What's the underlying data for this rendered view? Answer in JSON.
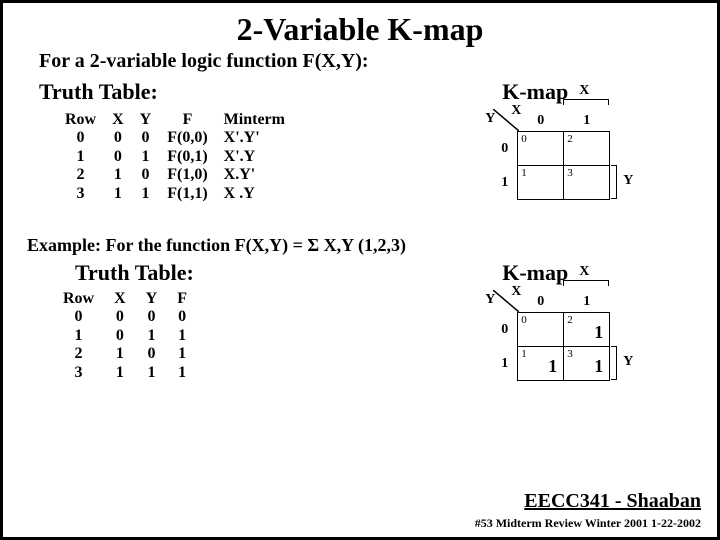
{
  "title": "2-Variable K-map",
  "subtitle": "For a 2-variable logic function F(X,Y):",
  "truth_label": "Truth Table:",
  "kmap_label": "K-map",
  "truth1": {
    "headers": [
      "Row",
      "X",
      "Y",
      "F",
      "Minterm"
    ],
    "rows": [
      [
        "0",
        "0",
        "0",
        "F(0,0)",
        "X'.Y'"
      ],
      [
        "1",
        "0",
        "1",
        "F(0,1)",
        "X'.Y"
      ],
      [
        "2",
        "1",
        "0",
        "F(1,0)",
        "X.Y'"
      ],
      [
        "3",
        "1",
        "1",
        "F(1,1)",
        "X .Y"
      ]
    ]
  },
  "kmap1": {
    "diag_y": "Y",
    "diag_x": "X",
    "col0": "0",
    "col1": "1",
    "row0": "0",
    "row1": "1",
    "cells": [
      {
        "sup": "0",
        "val": ""
      },
      {
        "sup": "2",
        "val": ""
      },
      {
        "sup": "1",
        "val": ""
      },
      {
        "sup": "3",
        "val": ""
      }
    ],
    "x_label": "X",
    "y_label": "Y"
  },
  "example_text": "Example:  For the function F(X,Y) = Σ X,Y (1,2,3)",
  "truth2": {
    "headers": [
      "Row",
      "X",
      "Y",
      "F"
    ],
    "rows": [
      [
        "0",
        "0",
        "0",
        "0"
      ],
      [
        "1",
        "0",
        "1",
        "1"
      ],
      [
        "2",
        "1",
        "0",
        "1"
      ],
      [
        "3",
        "1",
        "1",
        "1"
      ]
    ]
  },
  "kmap2": {
    "diag_y": "Y",
    "diag_x": "X",
    "col0": "0",
    "col1": "1",
    "row0": "0",
    "row1": "1",
    "cells": [
      {
        "sup": "0",
        "val": ""
      },
      {
        "sup": "2",
        "val": "1"
      },
      {
        "sup": "1",
        "val": "1"
      },
      {
        "sup": "3",
        "val": "1"
      }
    ],
    "x_label": "X",
    "y_label": "Y"
  },
  "footer1": "EECC341 - Shaaban",
  "footer2": "#53   Midterm Review   Winter 2001  1-22-2002"
}
